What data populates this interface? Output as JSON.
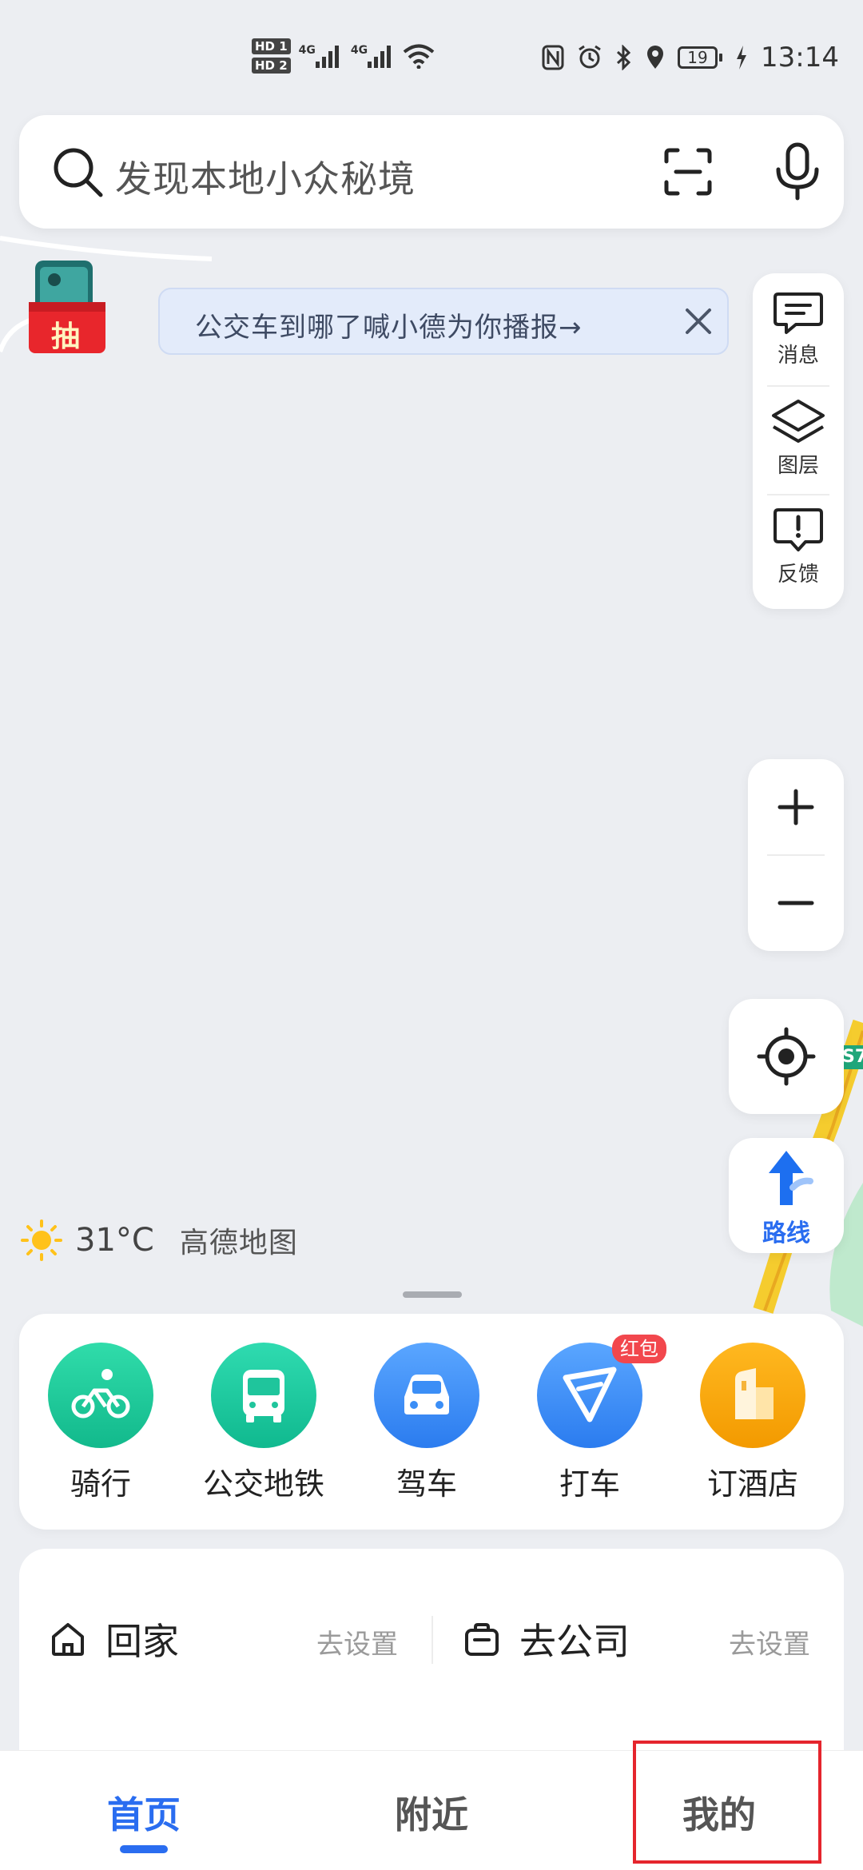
{
  "status_bar": {
    "time": "13:14",
    "battery": "19",
    "sim1": "HD 1",
    "sim2": "HD 2",
    "net1": "4G",
    "net2": "4G"
  },
  "search": {
    "placeholder": "发现本地小众秘境"
  },
  "notice": {
    "text": "公交车到哪了喊小德为你播报→"
  },
  "lottery": {
    "label": "抽"
  },
  "tools": [
    {
      "label": "消息",
      "icon": "message-icon"
    },
    {
      "label": "图层",
      "icon": "layers-icon"
    },
    {
      "label": "反馈",
      "icon": "feedback-icon"
    }
  ],
  "route": {
    "label": "路线"
  },
  "weather": {
    "temp": "31°C",
    "brand": "高德地图"
  },
  "map": {
    "road_badge": "S7"
  },
  "quick_actions": [
    {
      "label": "骑行",
      "icon": "bicycle-icon",
      "color": "#20c99a"
    },
    {
      "label": "公交地铁",
      "icon": "bus-icon",
      "color": "#1fc59c"
    },
    {
      "label": "驾车",
      "icon": "car-icon",
      "color": "#3b8ef6"
    },
    {
      "label": "打车",
      "icon": "taxi-icon",
      "color": "#3b8ef6",
      "badge": "红包"
    },
    {
      "label": "订酒店",
      "icon": "hotel-icon",
      "color": "#fba40c"
    }
  ],
  "commute": {
    "home_label": "回家",
    "home_action": "去设置",
    "company_label": "去公司",
    "company_action": "去设置"
  },
  "bottom_nav": [
    {
      "label": "首页",
      "active": true
    },
    {
      "label": "附近",
      "active": false
    },
    {
      "label": "我的",
      "active": false
    }
  ],
  "colors": {
    "accent": "#2a6df0",
    "highlight_box": "#e5252d"
  }
}
